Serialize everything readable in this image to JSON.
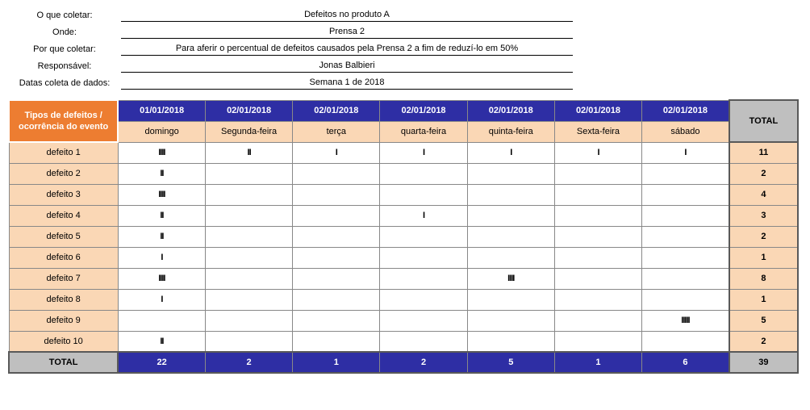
{
  "meta": {
    "rows": [
      {
        "label": "O que coletar:",
        "value": "Defeitos no produto A"
      },
      {
        "label": "Onde:",
        "value": "Prensa 2"
      },
      {
        "label": "Por que coletar:",
        "value": "Para aferir o percentual de defeitos causados pela Prensa 2 a fim de reduzí-lo em 50%"
      },
      {
        "label": "Responsável:",
        "value": "Jonas Balbieri"
      },
      {
        "label": "Datas coleta de dados:",
        "value": "Semana 1 de 2018"
      }
    ]
  },
  "table": {
    "corner": "Tipos de defeitos / ocorrência do evento",
    "total_label": "TOTAL",
    "dates": [
      "01/01/2018",
      "02/01/2018",
      "02/01/2018",
      "02/01/2018",
      "02/01/2018",
      "02/01/2018",
      "02/01/2018"
    ],
    "weekdays": [
      "domingo",
      "Segunda-feira",
      "terça",
      "quarta-feira",
      "quinta-feira",
      "Sexta-feira",
      "sábado"
    ],
    "rows": [
      {
        "label": "defeito 1",
        "tallies": [
          "IIII",
          "II",
          "I",
          "I",
          "I",
          "I",
          "I"
        ],
        "total": 11
      },
      {
        "label": "defeito 2",
        "tallies": [
          "II",
          "",
          "",
          "",
          "",
          "",
          ""
        ],
        "total": 2
      },
      {
        "label": "defeito 3",
        "tallies": [
          "IIII",
          "",
          "",
          "",
          "",
          "",
          ""
        ],
        "total": 4
      },
      {
        "label": "defeito 4",
        "tallies": [
          "II",
          "",
          "",
          "I",
          "",
          "",
          ""
        ],
        "total": 3
      },
      {
        "label": "defeito 5",
        "tallies": [
          "II",
          "",
          "",
          "",
          "",
          "",
          ""
        ],
        "total": 2
      },
      {
        "label": "defeito 6",
        "tallies": [
          "I",
          "",
          "",
          "",
          "",
          "",
          ""
        ],
        "total": 1
      },
      {
        "label": "defeito 7",
        "tallies": [
          "IIII",
          "",
          "",
          "",
          "IIII",
          "",
          ""
        ],
        "total": 8
      },
      {
        "label": "defeito 8",
        "tallies": [
          "I",
          "",
          "",
          "",
          "",
          "",
          ""
        ],
        "total": 1
      },
      {
        "label": "defeito 9",
        "tallies": [
          "",
          "",
          "",
          "",
          "",
          "",
          "IIIII"
        ],
        "total": 5
      },
      {
        "label": "defeito 10",
        "tallies": [
          "II",
          "",
          "",
          "",
          "",
          "",
          ""
        ],
        "total": 2
      }
    ],
    "col_totals": [
      22,
      2,
      1,
      2,
      5,
      1,
      6
    ],
    "grand_total": 39
  }
}
